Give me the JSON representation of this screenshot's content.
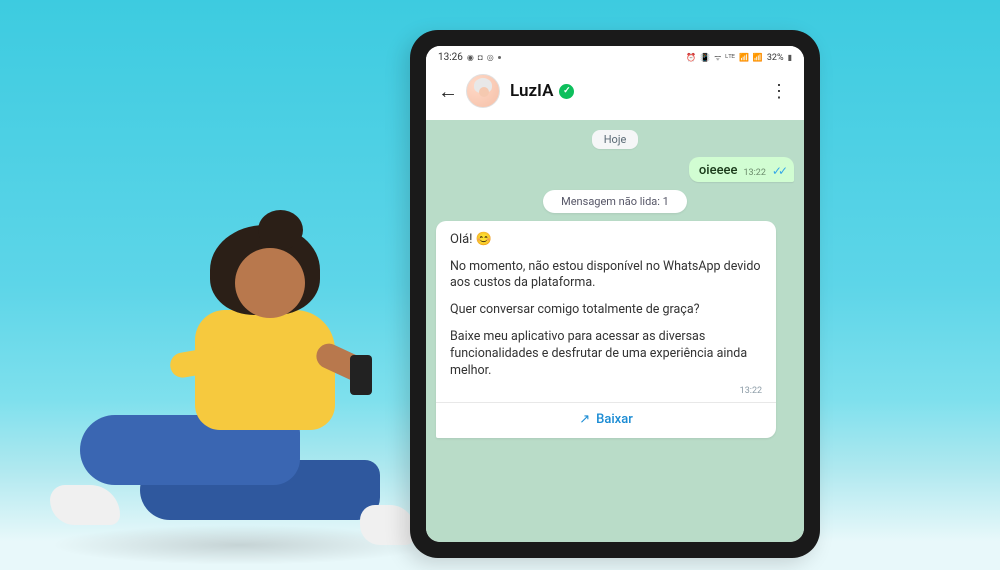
{
  "status_bar": {
    "time": "13:26",
    "left_icons": [
      "whatsapp-icon",
      "messenger-icon",
      "instagram-icon"
    ],
    "right_icons": [
      "alarm-icon",
      "vibrate-icon",
      "wifi-icon",
      "lte-icon",
      "signal-icon",
      "signal-icon"
    ],
    "battery_text": "32%"
  },
  "header": {
    "contact_name": "LuzIA",
    "verified": true
  },
  "chat": {
    "date_label": "Hoje",
    "outgoing": {
      "text": "oieeee",
      "time": "13:22"
    },
    "unread_label": "Mensagem não lida: 1",
    "incoming": {
      "line1": "Olá! 😊",
      "line2": "No momento, não estou disponível no WhatsApp devido aos custos da plataforma.",
      "line3": "Quer conversar comigo totalmente de graça?",
      "line4": "Baixe meu aplicativo para acessar as diversas funcionalidades e desfrutar de uma experiência ainda melhor.",
      "time": "13:22",
      "cta_label": "Baixar"
    }
  }
}
